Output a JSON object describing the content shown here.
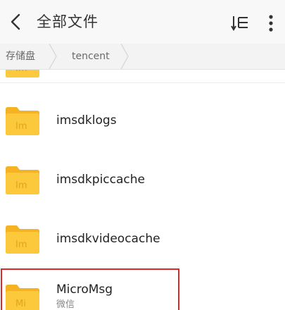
{
  "header": {
    "title": "全部文件",
    "back_icon": "chevron-left-icon",
    "sort_icon": "sort-icon",
    "more_icon": "more-vert-icon"
  },
  "breadcrumb": {
    "items": [
      "存储盘",
      "tencent"
    ]
  },
  "files": {
    "folder_badge": "Im",
    "items": [
      {
        "name": "imsdklogs",
        "badge": "Im"
      },
      {
        "name": "imsdkpiccache",
        "badge": "Im"
      },
      {
        "name": "imsdkvideocache",
        "badge": "Im"
      },
      {
        "name": "MicroMsg",
        "badge": "Mi",
        "subtitle": "微信"
      }
    ]
  },
  "colors": {
    "folder": "#fcc83c",
    "folder_tab": "#f5b324",
    "highlight": "#e0262d"
  }
}
